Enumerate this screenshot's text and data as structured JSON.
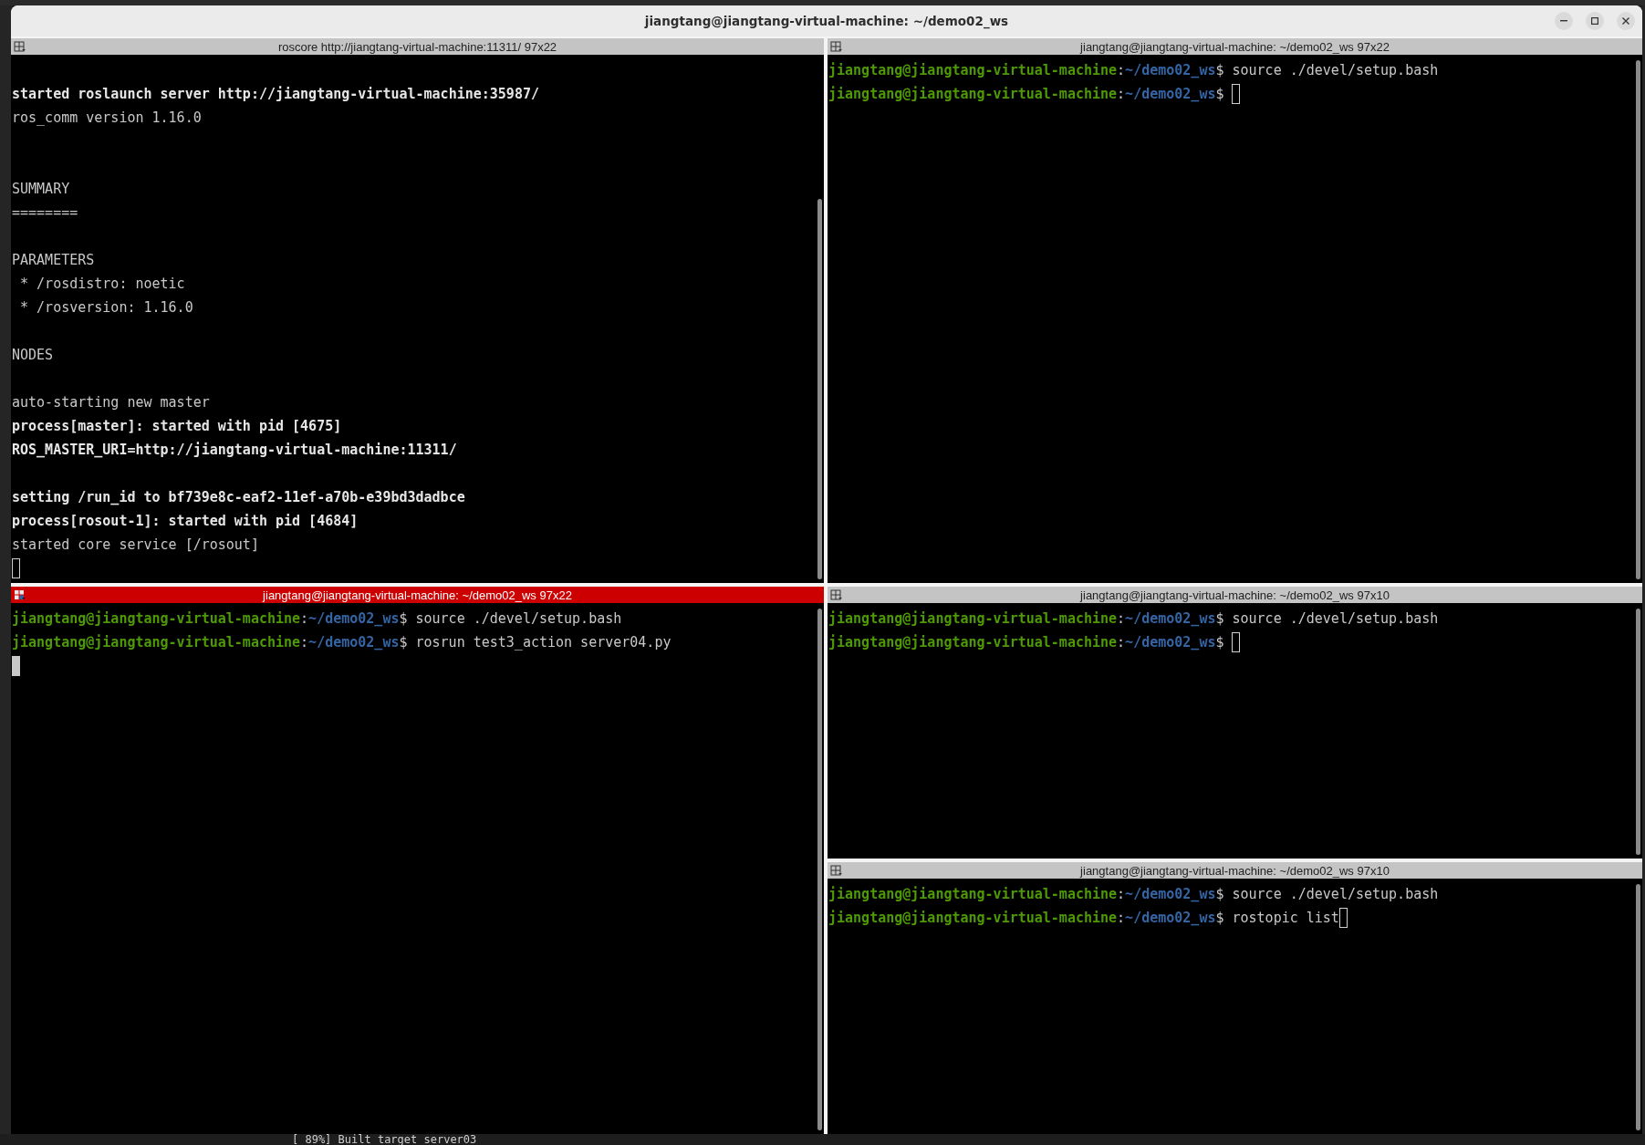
{
  "window": {
    "title": "jiangtang@jiangtang-virtual-machine: ~/demo02_ws"
  },
  "columns": [
    {
      "panes": [
        {
          "title": "roscore http://jiangtang-virtual-machine:11311/ 97x22",
          "focused": false,
          "lines": [
            {
              "kind": "blank"
            },
            {
              "kind": "plain",
              "bold": true,
              "text": "started roslaunch server http://jiangtang-virtual-machine:35987/"
            },
            {
              "kind": "plain",
              "bold": false,
              "text": "ros_comm version 1.16.0"
            },
            {
              "kind": "blank"
            },
            {
              "kind": "blank"
            },
            {
              "kind": "plain",
              "bold": false,
              "text": "SUMMARY"
            },
            {
              "kind": "plain",
              "bold": false,
              "text": "========"
            },
            {
              "kind": "blank"
            },
            {
              "kind": "plain",
              "bold": false,
              "text": "PARAMETERS"
            },
            {
              "kind": "plain",
              "bold": false,
              "text": " * /rosdistro: noetic"
            },
            {
              "kind": "plain",
              "bold": false,
              "text": " * /rosversion: 1.16.0"
            },
            {
              "kind": "blank"
            },
            {
              "kind": "plain",
              "bold": false,
              "text": "NODES"
            },
            {
              "kind": "blank"
            },
            {
              "kind": "plain",
              "bold": false,
              "text": "auto-starting new master"
            },
            {
              "kind": "plain",
              "bold": true,
              "text": "process[master]: started with pid [4675]"
            },
            {
              "kind": "plain",
              "bold": true,
              "text": "ROS_MASTER_URI=http://jiangtang-virtual-machine:11311/"
            },
            {
              "kind": "blank"
            },
            {
              "kind": "plain",
              "bold": true,
              "text": "setting /run_id to bf739e8c-eaf2-11ef-a70b-e39bd3dadbce"
            },
            {
              "kind": "plain",
              "bold": true,
              "text": "process[rosout-1]: started with pid [4684]"
            },
            {
              "kind": "plain",
              "bold": false,
              "text": "started core service [/rosout]"
            },
            {
              "kind": "blank"
            }
          ]
        },
        {
          "title": "jiangtang@jiangtang-virtual-machine: ~/demo02_ws 97x22",
          "focused": true,
          "lines": [
            {
              "kind": "prompt",
              "user_host": "jiangtang@jiangtang-virtual-machine",
              "separator": ":",
              "path": "~/demo02_ws",
              "symbol": "$",
              "command": "source ./devel/setup.bash"
            },
            {
              "kind": "prompt",
              "user_host": "jiangtang@jiangtang-virtual-machine",
              "separator": ":",
              "path": "~/demo02_ws",
              "symbol": "$",
              "command": "rosrun test3_action server04.py"
            },
            {
              "kind": "blank"
            }
          ]
        }
      ]
    },
    {
      "panes": [
        {
          "title": "jiangtang@jiangtang-virtual-machine: ~/demo02_ws 97x22",
          "focused": false,
          "lines": [
            {
              "kind": "prompt",
              "user_host": "jiangtang@jiangtang-virtual-machine",
              "separator": ":",
              "path": "~/demo02_ws",
              "symbol": "$",
              "command": "source ./devel/setup.bash"
            },
            {
              "kind": "prompt",
              "user_host": "jiangtang@jiangtang-virtual-machine",
              "separator": ":",
              "path": "~/demo02_ws",
              "symbol": "$"
            }
          ]
        },
        {
          "title": "jiangtang@jiangtang-virtual-machine: ~/demo02_ws 97x10",
          "focused": false,
          "lines": [
            {
              "kind": "prompt",
              "user_host": "jiangtang@jiangtang-virtual-machine",
              "separator": ":",
              "path": "~/demo02_ws",
              "symbol": "$",
              "command": "source ./devel/setup.bash"
            },
            {
              "kind": "prompt",
              "user_host": "jiangtang@jiangtang-virtual-machine",
              "separator": ":",
              "path": "~/demo02_ws",
              "symbol": "$"
            }
          ]
        },
        {
          "title": "jiangtang@jiangtang-virtual-machine: ~/demo02_ws 97x10",
          "focused": false,
          "lines": [
            {
              "kind": "prompt",
              "user_host": "jiangtang@jiangtang-virtual-machine",
              "separator": ":",
              "path": "~/demo02_ws",
              "symbol": "$",
              "command": "source ./devel/setup.bash"
            },
            {
              "kind": "prompt",
              "user_host": "jiangtang@jiangtang-virtual-machine",
              "separator": ":",
              "path": "~/demo02_ws",
              "symbol": "$",
              "command": "rostopic list"
            }
          ]
        }
      ]
    }
  ],
  "background_window": {
    "text": "[ 89%] Built target server03"
  }
}
